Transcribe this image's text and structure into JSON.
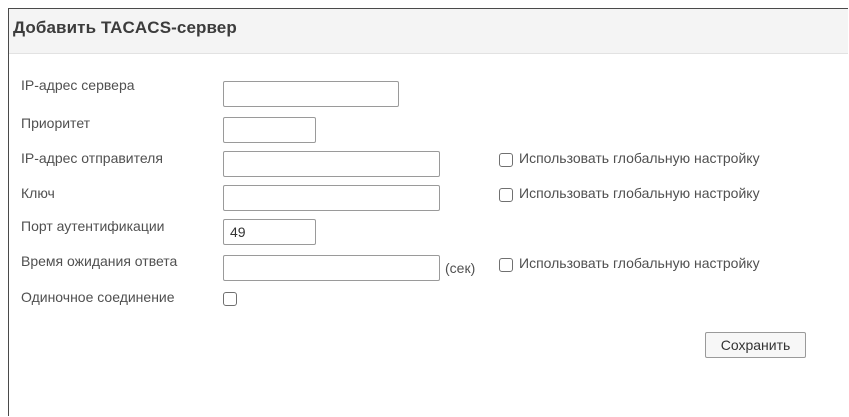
{
  "header": {
    "title": "Добавить TACACS-сервер"
  },
  "form": {
    "server_ip_label": "IP-адрес сервера",
    "server_ip_value": "",
    "priority_label": "Приоритет",
    "priority_value": "",
    "sender_ip_label": "IP-адрес отправителя",
    "sender_ip_value": "",
    "key_label": "Ключ",
    "key_value": "",
    "auth_port_label": "Порт аутентификации",
    "auth_port_value": "49",
    "timeout_label": "Время ожидания ответа",
    "timeout_value": "",
    "timeout_unit": "(сек)",
    "single_connection_label": "Одиночное соединение",
    "single_connection_checked": false,
    "use_global_label": "Использовать глобальную настройку",
    "sender_ip_use_global_checked": false,
    "key_use_global_checked": false,
    "timeout_use_global_checked": false
  },
  "actions": {
    "save_label": "Сохранить"
  }
}
